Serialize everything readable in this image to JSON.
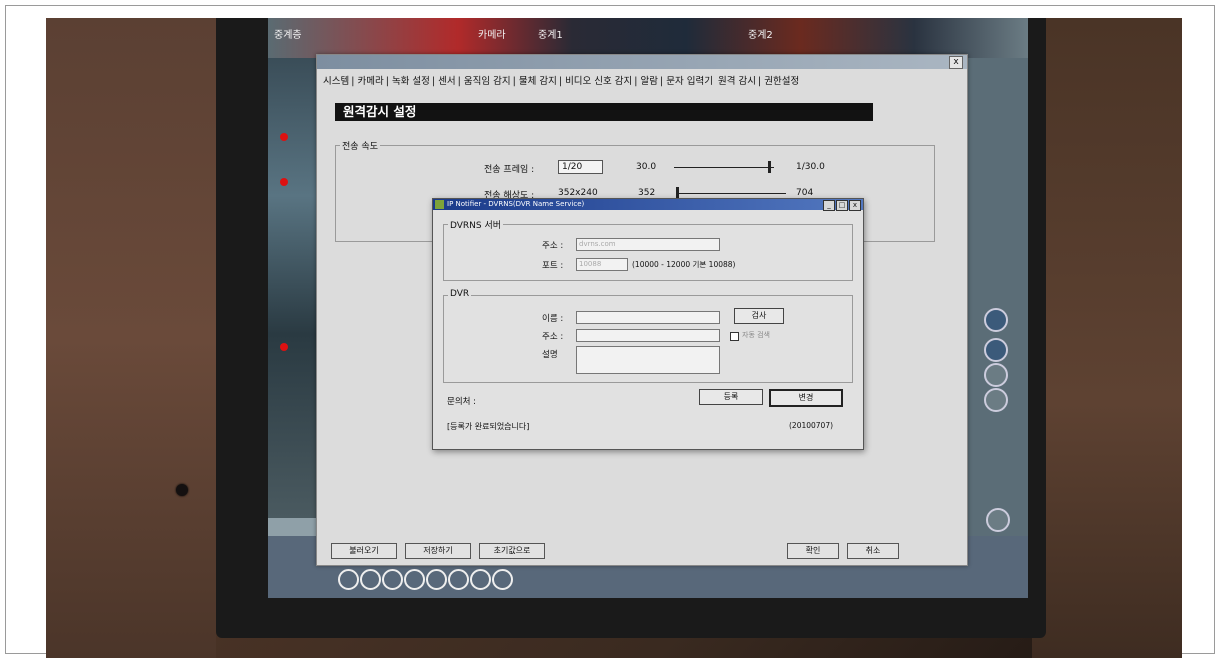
{
  "main_window": {
    "menu": [
      "시스템",
      "카메라",
      "녹화 설정",
      "센서",
      "움직임 감지",
      "물체 감지",
      "비디오 신호 감지",
      "알람",
      "문자 입력기",
      "원격 감시",
      "권한설정"
    ],
    "section_title": "원격감시 설정",
    "speed_group": {
      "label": "전송 속도",
      "frame_label": "전송 프레임 :",
      "frame_value": "1/20",
      "frame_min": "30.0",
      "frame_max": "1/30.0",
      "res_label": "전송 해상도 :",
      "res_value": "352x240",
      "res_min": "352",
      "res_max": "704"
    },
    "bottom_buttons": [
      "불러오기",
      "저장하기",
      "초기값으로"
    ],
    "ok_button": "확인",
    "cancel_button": "취소"
  },
  "dialog": {
    "title": "IP Notifier - DVRNS(DVR Name Service)",
    "dvrns_group": "DVRNS 서버",
    "address_label": "주소 :",
    "address_value": "dvrns.com",
    "port_label": "포트 :",
    "port_value": "10088",
    "port_hint": "(10000 - 12000 기본 10088)",
    "dvr_group": "DVR",
    "name_label": "이름 :",
    "name_value": "",
    "dvr_address_label": "주소 :",
    "dvr_address_value": "",
    "desc_label": "설명",
    "check_button": "검사",
    "auto_checkbox": "자동 검색",
    "contact_label": "문의처 :",
    "register_button": "등록",
    "change_button": "변경",
    "status": "[등록가 완료되었습니다]",
    "version": "(20100707)"
  },
  "screen": {
    "cam_labels": [
      "중계층",
      "카메라",
      "중계1",
      "중계2"
    ]
  }
}
